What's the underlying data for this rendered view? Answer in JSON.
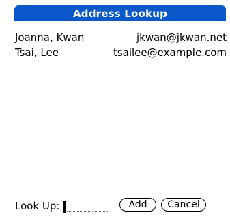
{
  "header": {
    "title": "Address Lookup"
  },
  "entries": [
    {
      "name": "Joanna, Kwan",
      "email": "jkwan@jkwan.net"
    },
    {
      "name": "Tsai, Lee",
      "email": "tsailee@example.com"
    }
  ],
  "lookup": {
    "label": "Look Up:",
    "value": ""
  },
  "buttons": {
    "add_label": "Add",
    "cancel_label": "Cancel"
  },
  "colors": {
    "titlebar": "#0a58c9",
    "background": "#ffffff"
  }
}
